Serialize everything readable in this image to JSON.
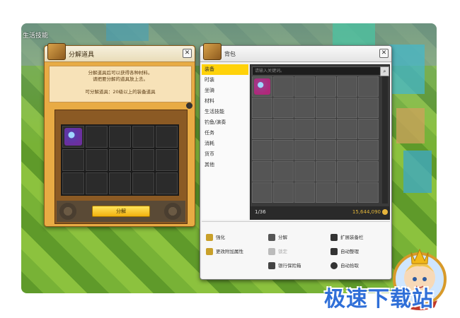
{
  "hud": {
    "skill_label": "生活技能"
  },
  "disassemble": {
    "title": "分解道具",
    "desc_line1": "分解道具后可以获得各种材料。",
    "desc_line2": "请把要分解的道具放上去。",
    "requirement": "可分解道具：20级以上的装备道具",
    "button_label": "分解",
    "close_icon": "close-icon"
  },
  "bag": {
    "title": "背包",
    "search_placeholder": "请输入关键词。",
    "categories": [
      "装备",
      "时装",
      "坐骑",
      "材料",
      "生活技能",
      "钓鱼/演奏",
      "任务",
      "消耗",
      "货币",
      "其他"
    ],
    "active_category": "装备",
    "slot_count": "1/36",
    "currency": "15,644,090",
    "actions": [
      {
        "label": "强化",
        "icon": "enhance-icon",
        "enabled": true
      },
      {
        "label": "分解",
        "icon": "disassemble-icon",
        "enabled": true
      },
      {
        "label": "扩展装备栏",
        "icon": "plus-icon",
        "enabled": true
      },
      {
        "label": "更改附加属性",
        "icon": "attribute-icon",
        "enabled": true
      },
      {
        "label": "锁定",
        "icon": "lock-icon",
        "enabled": false
      },
      {
        "label": "自动整理",
        "icon": "sort-icon",
        "enabled": true
      },
      {
        "label": "银行保险箱",
        "icon": "bank-icon",
        "enabled": true
      },
      {
        "label": "自动拾取",
        "icon": "gear-icon",
        "enabled": true
      }
    ]
  },
  "watermark": {
    "text": "极速下载站"
  },
  "colors": {
    "accent_yellow": "#ffd20a",
    "panel_orange": "#e8ab44",
    "currency_gold": "#e2b63a"
  }
}
